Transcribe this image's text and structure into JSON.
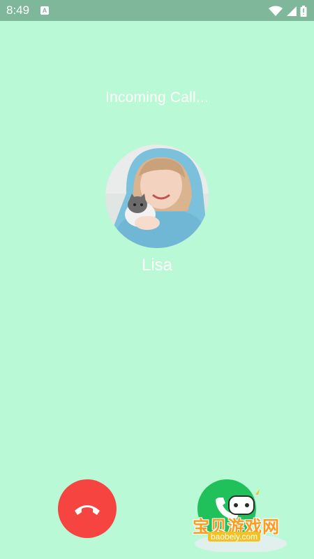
{
  "status_bar": {
    "time": "8:49",
    "notification_icon": "A",
    "icons": [
      "wifi-icon",
      "signal-icon",
      "battery-icon"
    ]
  },
  "call": {
    "status_text": "Incoming Call...",
    "caller_name": "Lisa"
  },
  "actions": {
    "decline": {
      "icon": "phone-hangup-icon",
      "color": "#f64440"
    },
    "accept": {
      "icon": "phone-icon",
      "color": "#20c05a"
    }
  },
  "watermark": {
    "title": "宝贝游戏网",
    "url": "baobeiy.com"
  },
  "colors": {
    "background": "#b9f9d6",
    "status_bar": "#7fb79a"
  }
}
